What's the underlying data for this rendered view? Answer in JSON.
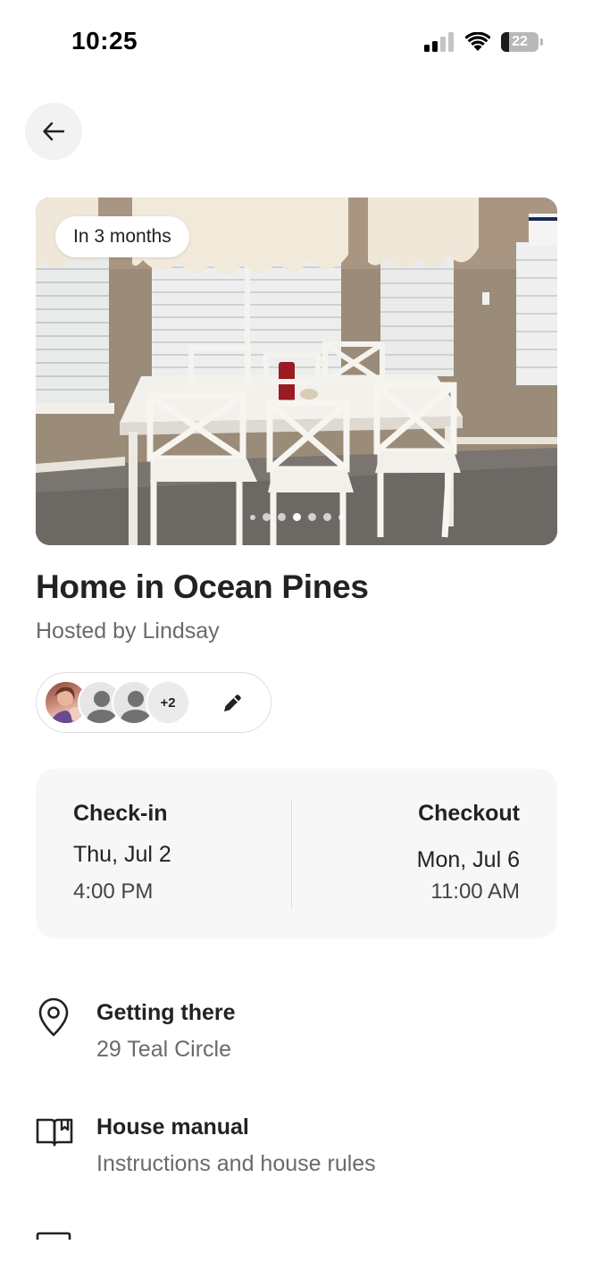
{
  "status_bar": {
    "time": "10:25",
    "battery_level": "22",
    "battery_fraction": 0.22
  },
  "listing": {
    "badge": "In 3 months",
    "photo_count": 7,
    "active_photo": 3,
    "title": "Home in Ocean Pines",
    "host": "Hosted by Lindsay"
  },
  "guests": {
    "extra_count": "+2"
  },
  "dates": {
    "checkin_label": "Check-in",
    "checkin_date": "Thu, Jul 2",
    "checkin_time": "4:00 PM",
    "checkout_label": "Checkout",
    "checkout_date": "Mon, Jul 6",
    "checkout_time": "11:00 AM"
  },
  "rows": [
    {
      "title": "Getting there",
      "subtitle": "29 Teal Circle",
      "icon": "location-pin-icon"
    },
    {
      "title": "House manual",
      "subtitle": "Instructions and house rules",
      "icon": "book-icon"
    }
  ],
  "colors": {
    "text_primary": "#222222",
    "text_secondary": "#6a6a6a",
    "card_bg": "#f7f7f7",
    "border": "#dddddd"
  }
}
